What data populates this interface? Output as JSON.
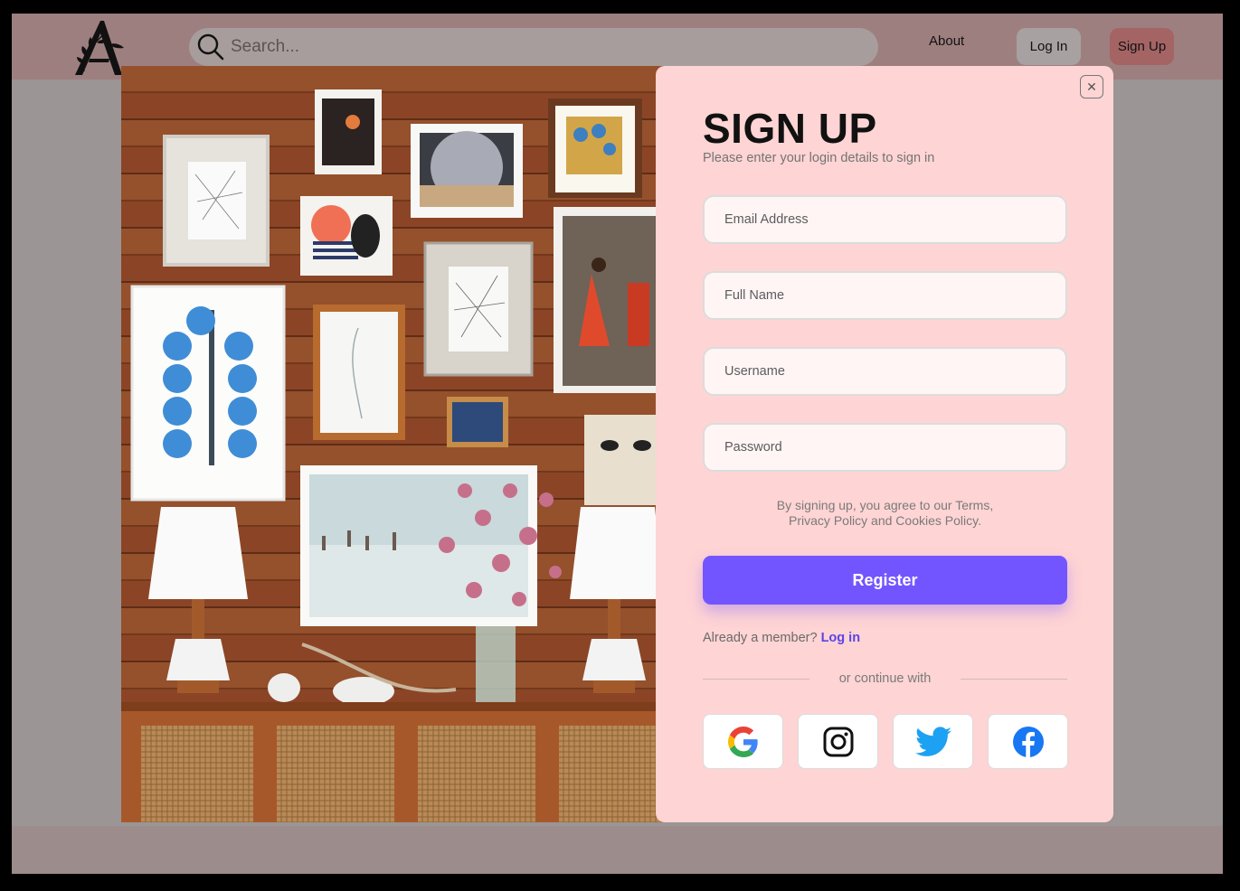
{
  "header": {
    "search_placeholder": "Search...",
    "nav_about": "About",
    "nav_login": "Log In",
    "nav_signup": "Sign Up"
  },
  "modal": {
    "title": "SIGN UP",
    "subtitle": "Please enter your login details to sign in",
    "close_icon": "close-icon",
    "fields": {
      "email_placeholder": "Email Address",
      "fullname_placeholder": "Full Name",
      "username_placeholder": "Username",
      "password_placeholder": "Password"
    },
    "terms_line1": "By signing up, you agree to our Terms,",
    "terms_line2": "Privacy Policy and Cookies Policy.",
    "register_label": "Register",
    "member_text": "Already a member?",
    "member_link": "Log in",
    "continue_text": "or continue with",
    "social": [
      "google-icon",
      "instagram-icon",
      "twitter-icon",
      "facebook-icon"
    ]
  },
  "colors": {
    "accent": "#7255ff",
    "card_bg": "#ffd4d4",
    "topbar_bg": "#9e7f7f",
    "signup_btn": "#a56464"
  }
}
